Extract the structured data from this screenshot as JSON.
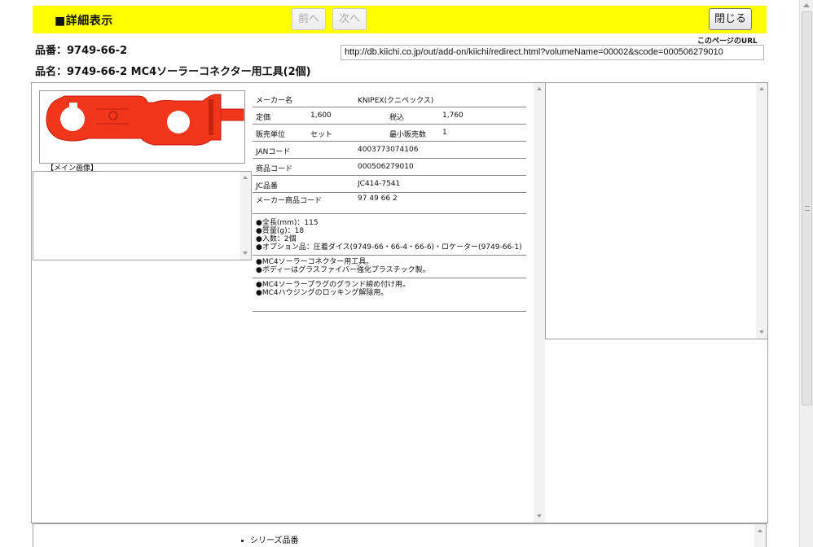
{
  "header": {
    "title": "■詳細表示",
    "prev_label": "前へ",
    "next_label": "次へ",
    "close_label": "閉じる",
    "accent_color": "#ffff00"
  },
  "product": {
    "part_no_line": "品番：9749-66-2",
    "part_name_line": "品名：9749-66-2 MC4ソーラーコネクター用工具(2個)",
    "url_label": "このページのURL",
    "url_value": "http://db.kiichi.co.jp/out/add-on/kiichi/redirect.html?volumeName=00002&scode=000506279010",
    "image_caption": "【メイン画像】"
  },
  "spec": {
    "maker_label": "メーカー名",
    "maker_value": "KNIPEX(クニペックス)",
    "price_label": "定価",
    "price_value": "1,600",
    "tax_label": "税込",
    "tax_value": "1,760",
    "unit_label": "販売単位",
    "unit_value": "セット",
    "min_label": "最小販売数",
    "min_value": "1",
    "jan_label": "JANコード",
    "jan_value": "4003773074106",
    "code_label": "商品コード",
    "code_value": "000506279010",
    "jc_label": "JC品番",
    "jc_value": "JC414-7541",
    "maker_code_label": "メーカー商品コード",
    "maker_code_value": "97 49 66 2",
    "details": [
      "●全長(mm)：115",
      "●質量(g)：18",
      "●入数：2個",
      "●オプション品：圧着ダイス(9749-66・66-4・66-6)・ロケーター(9749-66-1)"
    ],
    "features": [
      "●MC4ソーラーコネクター用工具。",
      "●ボディーはグラスファイバー強化プラスチック製。"
    ],
    "uses": [
      "●MC4ソーラープラグのグランド締め付け用。",
      "●MC4ハウジングのロッキング解除用。"
    ]
  },
  "bottom": {
    "series_label": "シリーズ品番"
  }
}
